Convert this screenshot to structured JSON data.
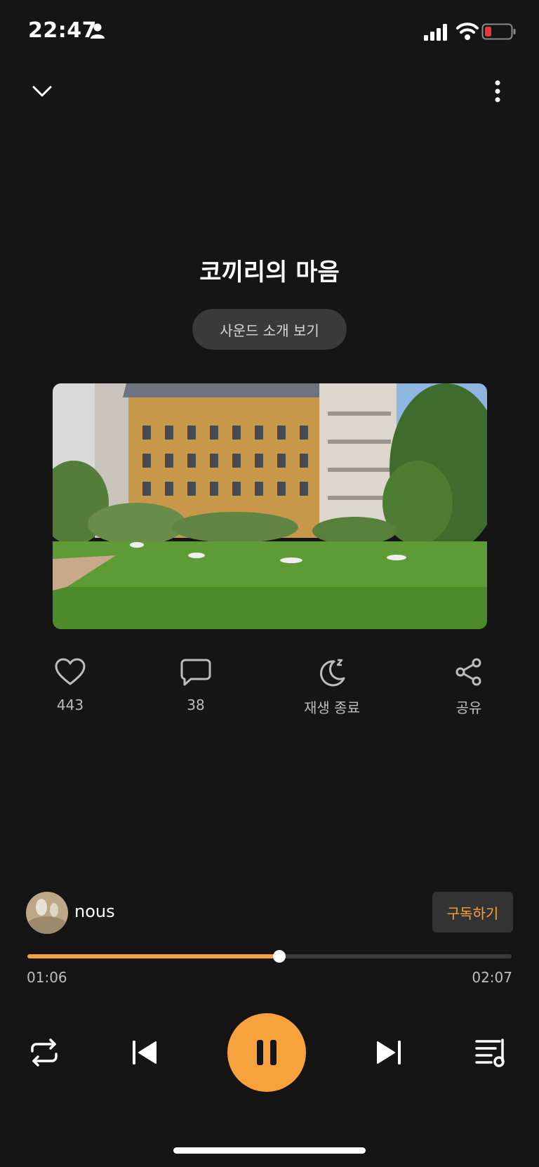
{
  "status_bar": {
    "time": "22:47"
  },
  "player": {
    "title": "코끼리의 마음",
    "intro_button": "사운드 소개 보기"
  },
  "actions": {
    "like_count": "443",
    "comment_count": "38",
    "sleep_label": "재생 종료",
    "share_label": "공유"
  },
  "channel": {
    "name": "nous",
    "subscribe_label": "구독하기"
  },
  "progress": {
    "current": "01:06",
    "total": "02:07",
    "fraction": 0.52
  },
  "colors": {
    "accent": "#f7a23c",
    "background": "#151515",
    "battery_low": "#e53935"
  },
  "icons": [
    "person-icon",
    "signal-icon",
    "wifi-icon",
    "battery-icon",
    "chevron-down-icon",
    "more-vertical-icon",
    "heart-icon",
    "comment-icon",
    "sleep-timer-icon",
    "share-icon",
    "repeat-icon",
    "skip-previous-icon",
    "pause-icon",
    "skip-next-icon",
    "playlist-icon"
  ]
}
